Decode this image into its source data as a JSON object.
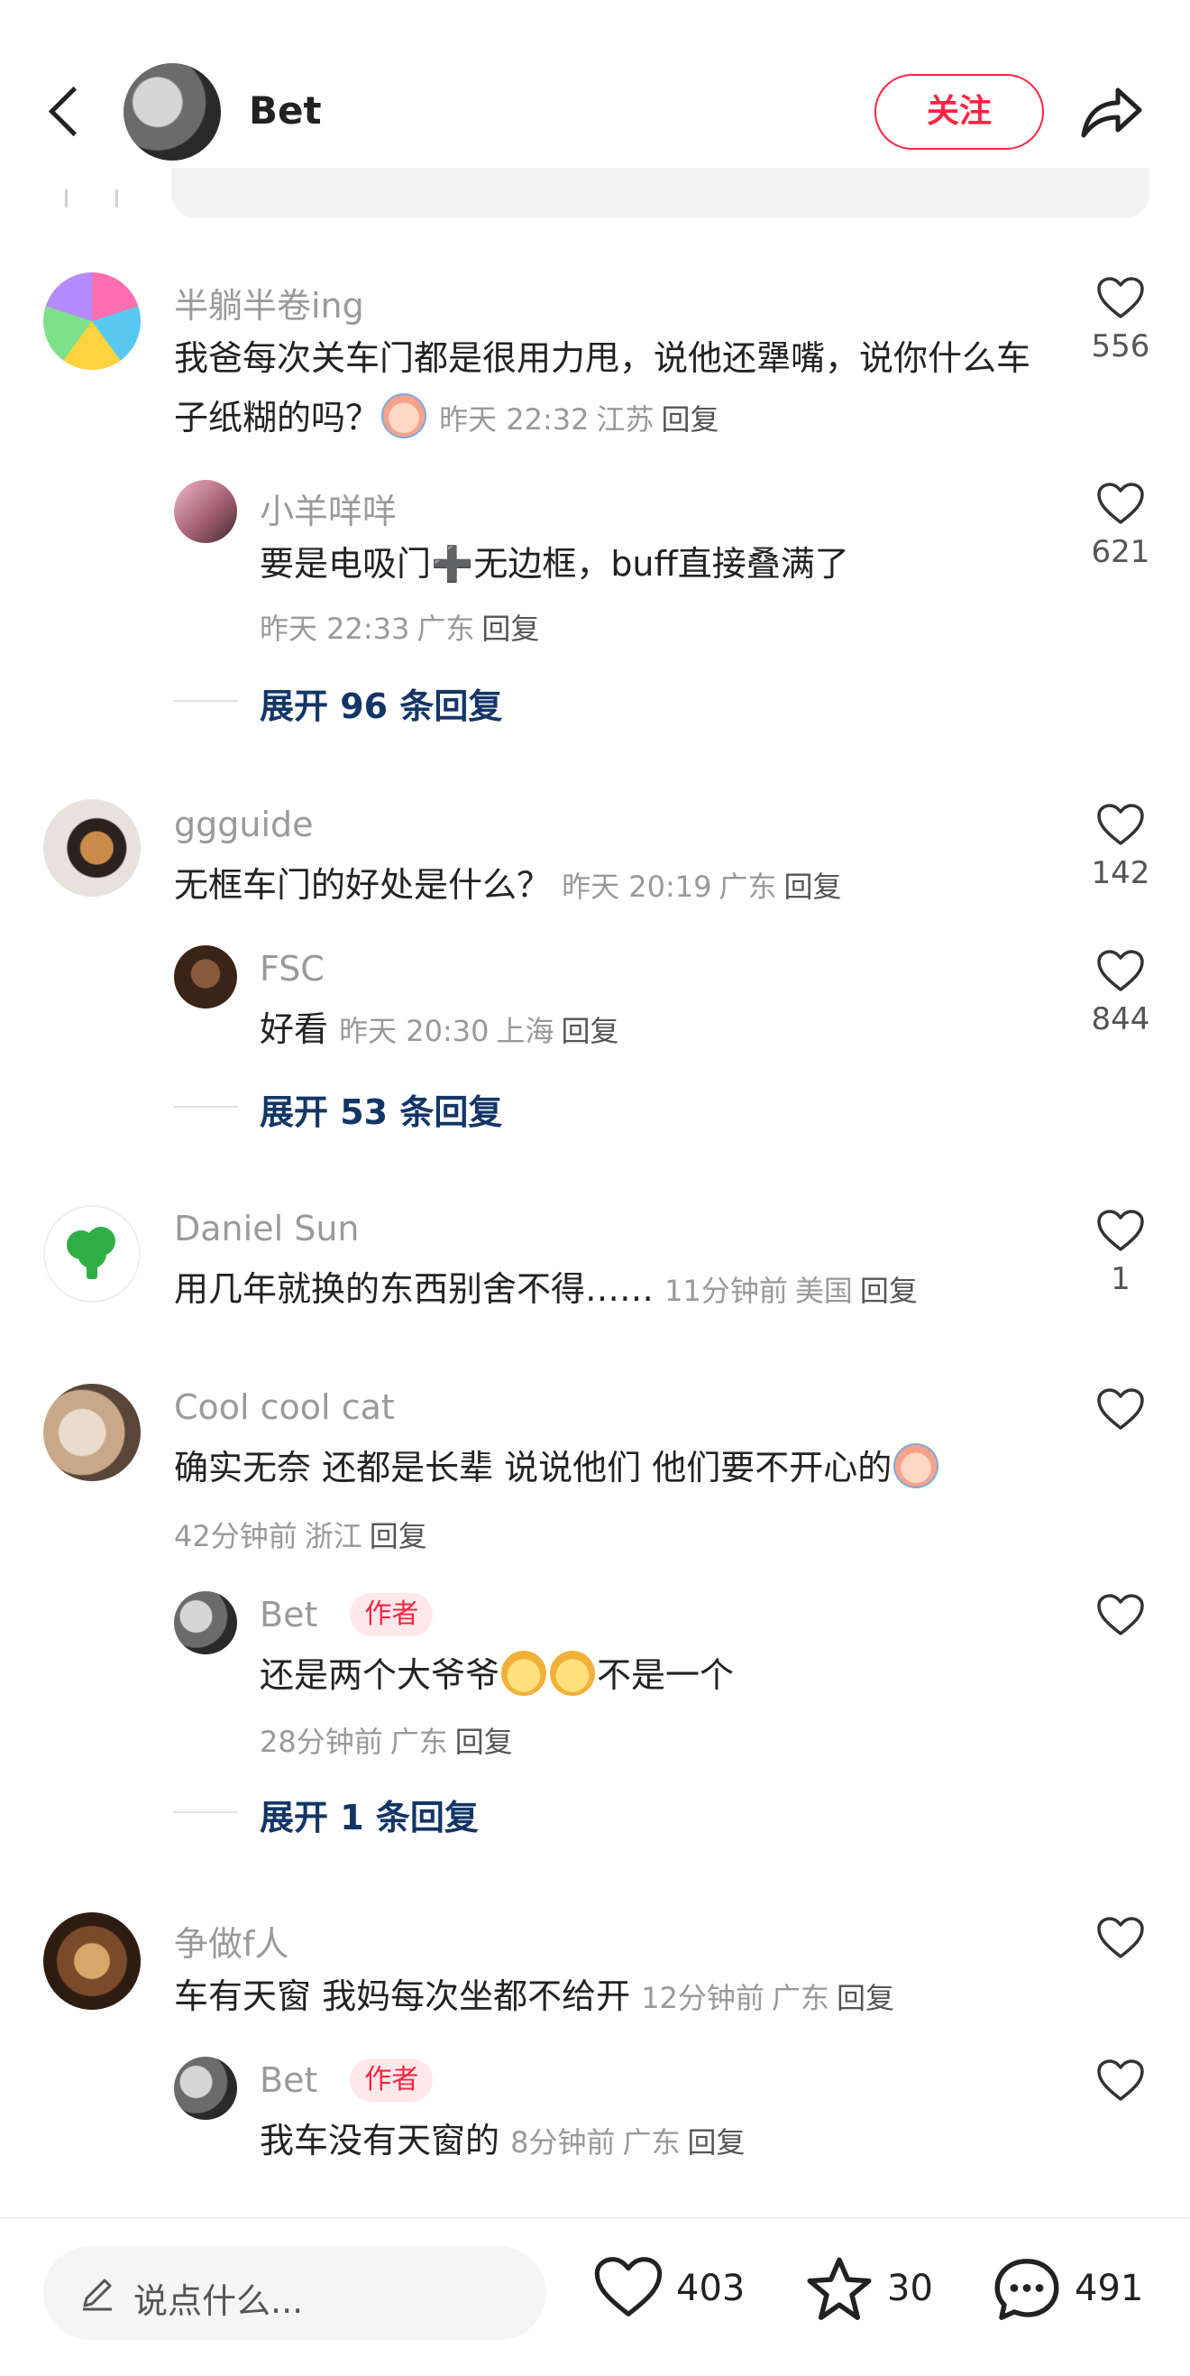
{
  "header": {
    "author_name": "Bet",
    "follow_label": "关注"
  },
  "comments": [
    {
      "user": "半躺半卷ing",
      "text": "我爸每次关车门都是很用力甩，说他还犟嘴，说你什么车子纸糊的吗？",
      "time": "昨天 22:32",
      "place": "江苏",
      "reply": "回复",
      "likes": "556",
      "sub": {
        "user": "小羊咩咩",
        "text": "要是电吸门➕无边框，buff直接叠满了",
        "time": "昨天 22:33",
        "place": "广东",
        "reply": "回复",
        "likes": "621"
      },
      "expand": "展开 96 条回复"
    },
    {
      "user": "ggguide",
      "text": "无框车门的好处是什么？",
      "time": "昨天 20:19",
      "place": "广东",
      "reply": "回复",
      "likes": "142",
      "sub": {
        "user": "FSC",
        "text": "好看",
        "time": "昨天 20:30",
        "place": "上海",
        "reply": "回复",
        "likes": "844"
      },
      "expand": "展开 53 条回复"
    },
    {
      "user": "Daniel Sun",
      "text": "用几年就换的东西别舍不得……",
      "time": "11分钟前",
      "place": "美国",
      "reply": "回复",
      "likes": "1"
    },
    {
      "user": "Cool cool cat",
      "text": "确实无奈 还都是长辈 说说他们 他们要不开心的",
      "time": "42分钟前",
      "place": "浙江",
      "reply": "回复",
      "sub": {
        "user": "Bet",
        "badge": "作者",
        "text_a": "还是两个大爷爷",
        "text_b": "不是一个",
        "time": "28分钟前",
        "place": "广东",
        "reply": "回复"
      },
      "expand": "展开 1 条回复"
    },
    {
      "user": "争做f人",
      "text": "车有天窗 我妈每次坐都不给开",
      "time": "12分钟前",
      "place": "广东",
      "reply": "回复",
      "sub": {
        "user": "Bet",
        "badge": "作者",
        "text": "我车没有天窗的",
        "time": "8分钟前",
        "place": "广东",
        "reply": "回复"
      }
    }
  ],
  "bottom_bar": {
    "input_placeholder": "说点什么...",
    "likes": "403",
    "stars": "30",
    "comments": "491"
  },
  "icons": {
    "back": "back-arrow-icon",
    "share": "share-icon",
    "like": "heart-icon",
    "star": "star-icon",
    "comment": "comment-bubble-icon",
    "pencil": "pencil-icon"
  },
  "colors": {
    "accent": "#ff2442",
    "expand_link": "#133667",
    "meta_gray": "#999999"
  }
}
